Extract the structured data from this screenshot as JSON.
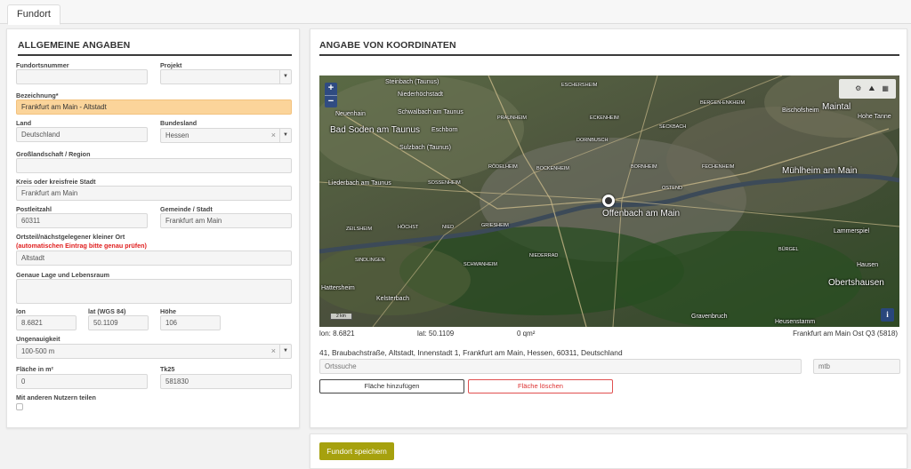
{
  "tab": {
    "label": "Fundort"
  },
  "left": {
    "title": "ALLGEMEINE ANGABEN",
    "fundortnummer": {
      "label": "Fundortsnummer",
      "value": ""
    },
    "projekt": {
      "label": "Projekt",
      "value": ""
    },
    "bezeichnung": {
      "label": "Bezeichnung*",
      "value": "Frankfurt am Main - Altstadt"
    },
    "land": {
      "label": "Land",
      "value": "Deutschland"
    },
    "bundesland": {
      "label": "Bundesland",
      "value": "Hessen"
    },
    "grosslandschaft": {
      "label": "Großlandschaft / Region",
      "value": ""
    },
    "kreis": {
      "label": "Kreis oder kreisfreie Stadt",
      "value": "Frankfurt am Main"
    },
    "plz": {
      "label": "Postleitzahl",
      "value": "60311"
    },
    "gemeinde": {
      "label": "Gemeinde / Stadt",
      "value": "Frankfurt am Main"
    },
    "ortsteil": {
      "label": "Ortsteil/nächstgelegener kleiner Ort",
      "warning": "(automatischen Eintrag bitte genau prüfen)",
      "value": "Altstadt"
    },
    "lage": {
      "label": "Genaue Lage und Lebensraum",
      "value": ""
    },
    "lon": {
      "label": "lon",
      "value": "8.6821"
    },
    "lat": {
      "label": "lat (WGS 84)",
      "value": "50.1109"
    },
    "hoehe": {
      "label": "Höhe",
      "value": "106"
    },
    "ungenauigkeit": {
      "label": "Ungenauigkeit",
      "value": "100-500 m"
    },
    "flaeche": {
      "label": "Fläche in m²",
      "value": "0"
    },
    "tk25": {
      "label": "Tk25",
      "value": "581830"
    },
    "teilen": {
      "label": "Mit anderen Nutzern teilen",
      "checked": false
    }
  },
  "right": {
    "title": "ANGABE VON KOORDINATEN",
    "map": {
      "labels": {
        "offenbach": "Offenbach am Main",
        "bad_soden": "Bad Soden am Taunus",
        "schwalbach": "Schwalbach am Taunus",
        "muehlheim": "Mühlheim am Main",
        "maintal": "Maintal",
        "eschborn": "Eschborn",
        "liederbach": "Liederbach am Taunus",
        "obertshausen": "Obertshausen",
        "neuenhain": "Neuenhain",
        "sulzbach": "Sulzbach (Taunus)",
        "eschersheim": "ESCHERSHEIM",
        "bockenheim": "BOCKENHEIM",
        "bornheim": "BORNHEIM",
        "fechenheim": "FECHENHEIM",
        "sossenheim": "SOSSENHEIM",
        "griesheim": "GRIESHEIM",
        "niederrad": "NIEDERRAD",
        "hoechst": "HÖCHST",
        "nied": "NIED",
        "zeilsheim": "ZEILSHEIM",
        "sindlingen": "SINDLINGEN",
        "schwanheim": "SCHWANHEIM",
        "lammerspiel": "Lammerspiel",
        "hausen": "Hausen",
        "kelsterbach": "Kelsterbach",
        "hattersheim": "Hattersheim",
        "ostend": "OSTEND",
        "seckbach": "SECKBACH",
        "praunheim": "PRAUNHEIM",
        "eckenheim": "ECKENHEIM",
        "bergen": "BERGEN-ENKHEIM",
        "bischofsheim": "Bischofsheim",
        "hohe_tanne": "Hohe Tanne",
        "rodelheim": "RÖDELHEIM",
        "dornbusch": "DORNBUSCH",
        "rumpenheim": "RUMPENHEIM",
        "buerger": "BÜRGEL",
        "gravenbruch": "Gravenbruch",
        "heusenstamm": "Heusenstamm",
        "steinbach": "Steinbach (Taunus)",
        "niederhoechstadt": "Niederhöchstadt"
      },
      "scale": "2 km",
      "controls": {
        "zoom_in": "+",
        "zoom_out": "−",
        "info": "i",
        "layers": "⚙ ⛰ ▦"
      }
    },
    "status": {
      "lon": "lon: 8.6821",
      "lat": "lat: 50.1109",
      "area": "0 qm²",
      "region": "Frankfurt am Main Ost Q3 (5818)"
    },
    "address": "41, Braubachstraße, Altstadt, Innenstadt 1, Frankfurt am Main, Hessen, 60311, Deutschland",
    "ortsuche": {
      "placeholder": "Ortssuche"
    },
    "mtb": {
      "placeholder": "mtb"
    },
    "add_area": "Fläche hinzufügen",
    "delete_area": "Fläche löschen"
  },
  "save": {
    "label": "Fundort speichern",
    "color": "#a6a10e"
  }
}
